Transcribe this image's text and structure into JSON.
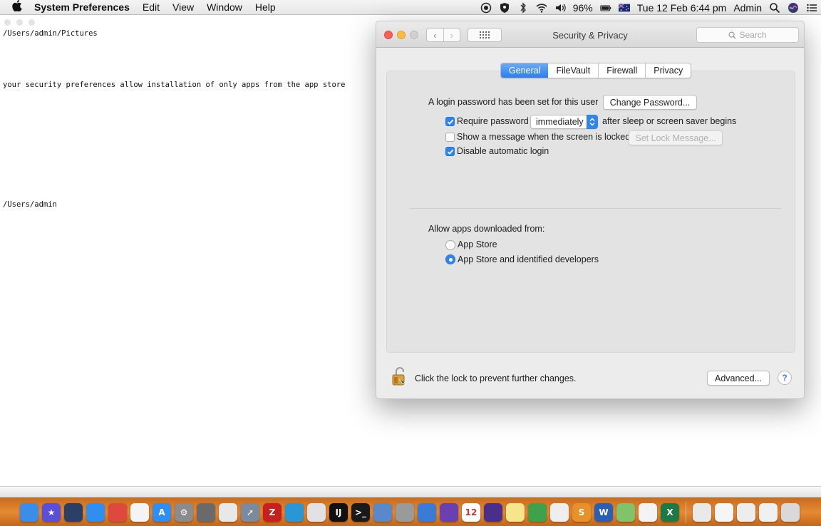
{
  "menubar": {
    "app_name": "System Preferences",
    "menus": [
      "Edit",
      "View",
      "Window",
      "Help"
    ],
    "battery_percent": "96%",
    "datetime": "Tue 12 Feb  6:44 pm",
    "user": "Admin"
  },
  "terminal": {
    "lines": [
      "/Users/admin/Pictures",
      "your security preferences allow installation of only apps from the app store",
      "/Users/admin"
    ]
  },
  "window": {
    "title": "Security & Privacy",
    "search_placeholder": "Search",
    "tabs": [
      {
        "label": "General",
        "active": true
      },
      {
        "label": "FileVault",
        "active": false
      },
      {
        "label": "Firewall",
        "active": false
      },
      {
        "label": "Privacy",
        "active": false
      }
    ],
    "general": {
      "login_password_text": "A login password has been set for this user",
      "change_password_button": "Change Password...",
      "require_password_label": "Require password",
      "require_password_checked": true,
      "require_password_value": "immediately",
      "after_sleep_text": "after sleep or screen saver begins",
      "show_message_label": "Show a message when the screen is locked",
      "show_message_checked": false,
      "set_lock_message_button": "Set Lock Message...",
      "disable_auto_login_label": "Disable automatic login",
      "disable_auto_login_checked": true,
      "allow_apps_heading": "Allow apps downloaded from:",
      "options": [
        {
          "label": "App Store",
          "selected": false
        },
        {
          "label": "App Store and identified developers",
          "selected": true
        }
      ]
    },
    "footer": {
      "lock_text": "Click the lock to prevent further changes.",
      "advanced_button": "Advanced...",
      "help_label": "?"
    }
  },
  "dock": {
    "calendar_day": "12",
    "apps": [
      {
        "name": "finder-icon",
        "color": "#3b8ee8",
        "glyph": ""
      },
      {
        "name": "imovie-icon",
        "color": "#5a4fd8",
        "glyph": "★"
      },
      {
        "name": "quicktime-icon",
        "color": "#2a3e66",
        "glyph": ""
      },
      {
        "name": "safari-icon",
        "color": "#2f8ef0",
        "glyph": ""
      },
      {
        "name": "chrome-icon",
        "color": "#dd4a3c",
        "glyph": ""
      },
      {
        "name": "textedit-icon",
        "color": "#f4f4f4",
        "glyph": ""
      },
      {
        "name": "app-store-icon",
        "color": "#2f8ef0",
        "glyph": "A"
      },
      {
        "name": "system-preferences-icon",
        "color": "#8b8b8b",
        "glyph": "⚙"
      },
      {
        "name": "disk-utility-icon",
        "color": "#6a6a6a",
        "glyph": ""
      },
      {
        "name": "sequel-pro-icon",
        "color": "#e8e8e8",
        "glyph": ""
      },
      {
        "name": "launchpad-icon",
        "color": "#7c8aa0",
        "glyph": "➚"
      },
      {
        "name": "filezilla-icon",
        "color": "#c8201f",
        "glyph": "Z"
      },
      {
        "name": "docker-icon",
        "color": "#2996d6",
        "glyph": ""
      },
      {
        "name": "notes-icon",
        "color": "#e2e2e2",
        "glyph": ""
      },
      {
        "name": "intellij-icon",
        "color": "#111111",
        "glyph": "IJ"
      },
      {
        "name": "terminal-icon",
        "color": "#1a1a1a",
        "glyph": ">_"
      },
      {
        "name": "preview-icon",
        "color": "#5a88c8",
        "glyph": ""
      },
      {
        "name": "automator-icon",
        "color": "#9a9a9a",
        "glyph": ""
      },
      {
        "name": "xcode-icon",
        "color": "#3a7bd5",
        "glyph": ""
      },
      {
        "name": "visual-studio-icon",
        "color": "#6a3fb0",
        "glyph": ""
      },
      {
        "name": "calendar-icon",
        "color": "#ffffff",
        "glyph": "12"
      },
      {
        "name": "eclipse-icon",
        "color": "#4a2f8a",
        "glyph": ""
      },
      {
        "name": "stickies-icon",
        "color": "#f6e58d",
        "glyph": ""
      },
      {
        "name": "android-studio-icon",
        "color": "#3ea24a",
        "glyph": ""
      },
      {
        "name": "script-editor-icon",
        "color": "#eeeeee",
        "glyph": ""
      },
      {
        "name": "sublime-icon",
        "color": "#e8902a",
        "glyph": "S"
      },
      {
        "name": "word-icon",
        "color": "#2b5fb3",
        "glyph": "W"
      },
      {
        "name": "maps-icon",
        "color": "#7fc36b",
        "glyph": ""
      },
      {
        "name": "photos-icon",
        "color": "#f3f3f3",
        "glyph": ""
      },
      {
        "name": "excel-icon",
        "color": "#1e7a43",
        "glyph": "X"
      }
    ],
    "stacks": [
      {
        "name": "downloads-stack-icon",
        "color": "#e9e9e9"
      },
      {
        "name": "documents-stack-icon",
        "color": "#f5f5f5"
      },
      {
        "name": "filezilla-stack-icon",
        "color": "#ededed"
      },
      {
        "name": "folder-stack-icon",
        "color": "#f0f0f0"
      },
      {
        "name": "trash-icon",
        "color": "#d9d9d9"
      }
    ]
  }
}
